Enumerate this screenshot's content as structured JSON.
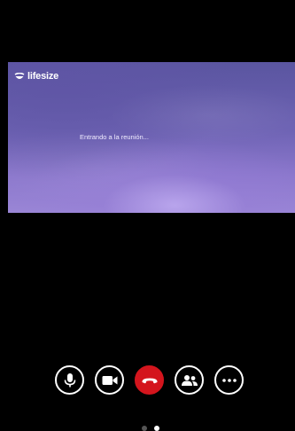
{
  "logo": {
    "text": "lifesize",
    "icon": "lifesize-logo-icon"
  },
  "video": {
    "status_text": "Entrando a la reunión..."
  },
  "controls": [
    {
      "name": "microphone-button",
      "icon": "microphone-icon"
    },
    {
      "name": "camera-button",
      "icon": "video-camera-icon"
    },
    {
      "name": "end-call-button",
      "icon": "phone-hangup-icon"
    },
    {
      "name": "participants-button",
      "icon": "people-icon"
    },
    {
      "name": "more-options-button",
      "icon": "more-icon"
    }
  ],
  "colors": {
    "background": "#000000",
    "end_call": "#d4151d",
    "icon": "#ffffff"
  },
  "pager": {
    "count": 2,
    "active": 1
  }
}
